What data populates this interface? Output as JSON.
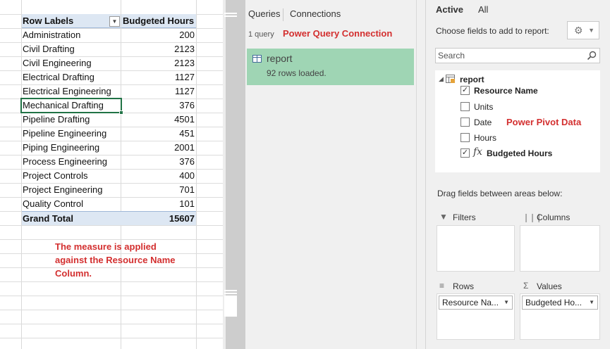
{
  "pivot": {
    "header_row_labels": "Row Labels",
    "header_value": "Budgeted Hours",
    "rows": [
      {
        "label": "Administration",
        "value": "200"
      },
      {
        "label": "Civil Drafting",
        "value": "2123"
      },
      {
        "label": "Civil Engineering",
        "value": "2123"
      },
      {
        "label": "Electrical Drafting",
        "value": "1127"
      },
      {
        "label": "Electrical Engineering",
        "value": "1127"
      },
      {
        "label": "Mechanical Drafting",
        "value": "376"
      },
      {
        "label": "Pipeline Drafting",
        "value": "4501"
      },
      {
        "label": "Pipeline Engineering",
        "value": "451"
      },
      {
        "label": "Piping Engineering",
        "value": "2001"
      },
      {
        "label": "Process Engineering",
        "value": "376"
      },
      {
        "label": "Project Controls",
        "value": "400"
      },
      {
        "label": "Project Engineering",
        "value": "701"
      },
      {
        "label": "Quality Control",
        "value": "101"
      }
    ],
    "total_label": "Grand Total",
    "total_value": "15607",
    "selected_cell": "Mechanical Drafting"
  },
  "annotation_note": "The measure is applied against the Resource Name Column.",
  "queries_pane": {
    "tabs": [
      "Queries",
      "Connections"
    ],
    "count": "1 query",
    "annotation": "Power Query Connection",
    "query": {
      "name": "report",
      "status": "92 rows loaded."
    }
  },
  "field_list": {
    "tabs": [
      "Active",
      "All"
    ],
    "active_tab": "Active",
    "choose_label": "Choose fields to add to report:",
    "search_placeholder": "Search",
    "table_name": "report",
    "fields": [
      {
        "name": "Resource Name",
        "checked": true,
        "measure": false
      },
      {
        "name": "Units",
        "checked": false,
        "measure": false
      },
      {
        "name": "Date",
        "checked": false,
        "measure": false
      },
      {
        "name": "Hours",
        "checked": false,
        "measure": false
      },
      {
        "name": "Budgeted Hours",
        "checked": true,
        "measure": true
      }
    ],
    "annotation": "Power Pivot Data",
    "drag_label": "Drag fields between areas below:",
    "areas": {
      "filters": "Filters",
      "columns": "Columns",
      "rows": "Rows",
      "values": "Values",
      "rows_chip": "Resource Na...",
      "values_chip": "Budgeted Ho..."
    }
  },
  "icons": {
    "gear": "gear-icon",
    "search": "search-icon",
    "filter": "filter-icon",
    "columns": "columns-icon",
    "rows": "rows-icon",
    "sigma": "sigma-icon"
  },
  "colors": {
    "pivot_header": "#dde7f3",
    "selection": "#217346",
    "annotation": "#d32f2f",
    "query_card": "#9fd5b4"
  }
}
